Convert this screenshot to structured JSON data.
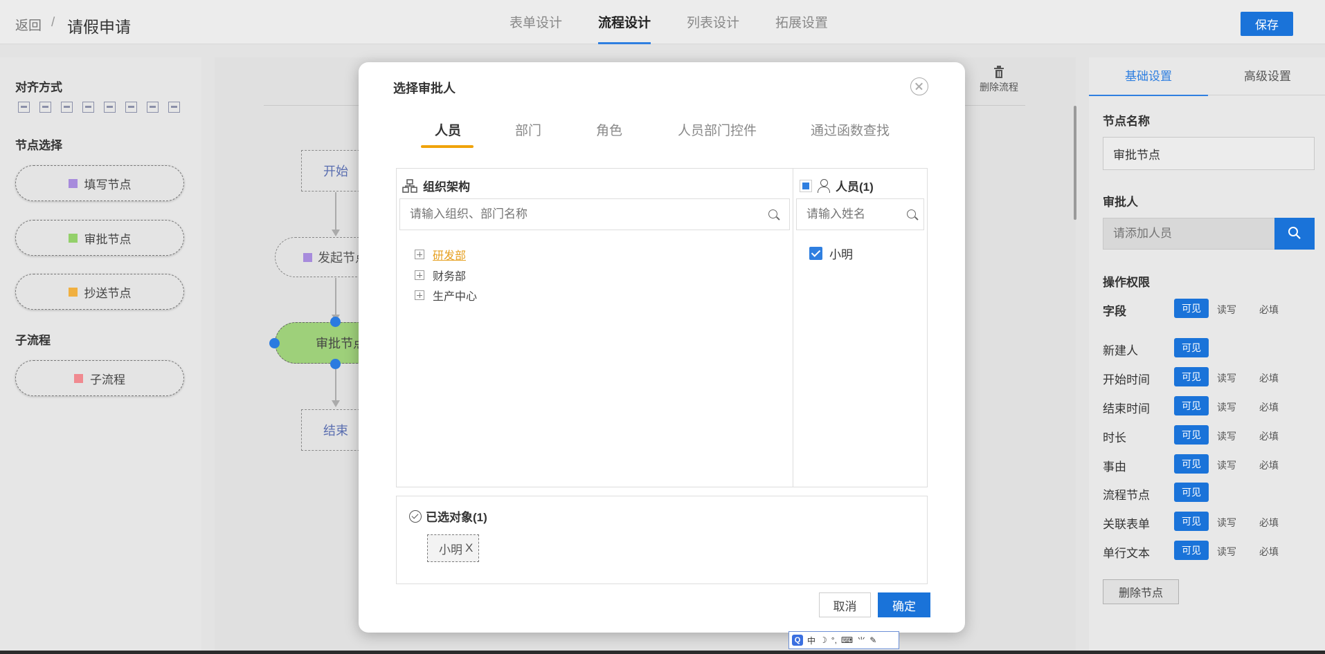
{
  "header": {
    "back_label": "返回",
    "separator": "/",
    "title": "请假申请",
    "tabs": [
      {
        "label": "表单设计"
      },
      {
        "label": "流程设计"
      },
      {
        "label": "列表设计"
      },
      {
        "label": "拓展设置"
      }
    ],
    "active_tab": "流程设计",
    "save_label": "保存"
  },
  "left_panel": {
    "align_title": "对齐方式",
    "node_select_title": "节点选择",
    "nodes": [
      {
        "label": "填写节点",
        "color": "#a78bdc"
      },
      {
        "label": "审批节点",
        "color": "#93d06a"
      },
      {
        "label": "抄送节点",
        "color": "#f0b040"
      }
    ],
    "subflow_title": "子流程",
    "subflow": {
      "label": "子流程",
      "color": "#f08a90"
    }
  },
  "canvas": {
    "start_label": "开始",
    "initiate_label": "发起节点",
    "approve_label": "审批节点",
    "end_label": "结束",
    "delete_flow_label": "删除流程"
  },
  "right_panel": {
    "tabs": [
      "基础设置",
      "高级设置"
    ],
    "active_tab": "基础设置",
    "node_name_label": "节点名称",
    "node_name_value": "审批节点",
    "approver_label": "审批人",
    "approver_placeholder": "请添加人员",
    "perm_label": "操作权限",
    "perm_rows": [
      {
        "name": "字段",
        "visible": "可见",
        "readwrite": "读写",
        "required": "必填"
      },
      {
        "name": "新建人",
        "visible": "可见"
      },
      {
        "name": "开始时间",
        "visible": "可见",
        "readwrite": "读写",
        "required": "必填"
      },
      {
        "name": "结束时间",
        "visible": "可见",
        "readwrite": "读写",
        "required": "必填"
      },
      {
        "name": "时长",
        "visible": "可见",
        "readwrite": "读写",
        "required": "必填"
      },
      {
        "name": "事由",
        "visible": "可见",
        "readwrite": "读写",
        "required": "必填"
      },
      {
        "name": "流程节点",
        "visible": "可见"
      },
      {
        "name": "关联表单",
        "visible": "可见",
        "readwrite": "读写",
        "required": "必填"
      },
      {
        "name": "单行文本",
        "visible": "可见",
        "readwrite": "读写",
        "required": "必填"
      }
    ],
    "delete_node_label": "删除节点"
  },
  "modal": {
    "title": "选择审批人",
    "tabs": [
      "人员",
      "部门",
      "角色",
      "人员部门控件",
      "通过函数查找"
    ],
    "active_tab": "人员",
    "org_title": "组织架构",
    "org_search_placeholder": "请输入组织、部门名称",
    "org_tree": [
      {
        "label": "研发部",
        "active": true
      },
      {
        "label": "财务部"
      },
      {
        "label": "生产中心"
      }
    ],
    "people_title": "人员(1)",
    "people_search_placeholder": "请输入姓名",
    "people": [
      {
        "name": "小明",
        "checked": true
      }
    ],
    "selected_title": "已选对象(1)",
    "selected_tags": [
      {
        "label": "小明"
      }
    ],
    "tag_close": "X",
    "cancel_label": "取消",
    "ok_label": "确定"
  },
  "ime_bar": {
    "logo": "Q",
    "mode": "中"
  },
  "colors": {
    "primary": "#1a73d9",
    "tab_accent": "#f0a30a",
    "active_dept": "#e6a020",
    "approve_node_fill": "#9ed07a"
  }
}
